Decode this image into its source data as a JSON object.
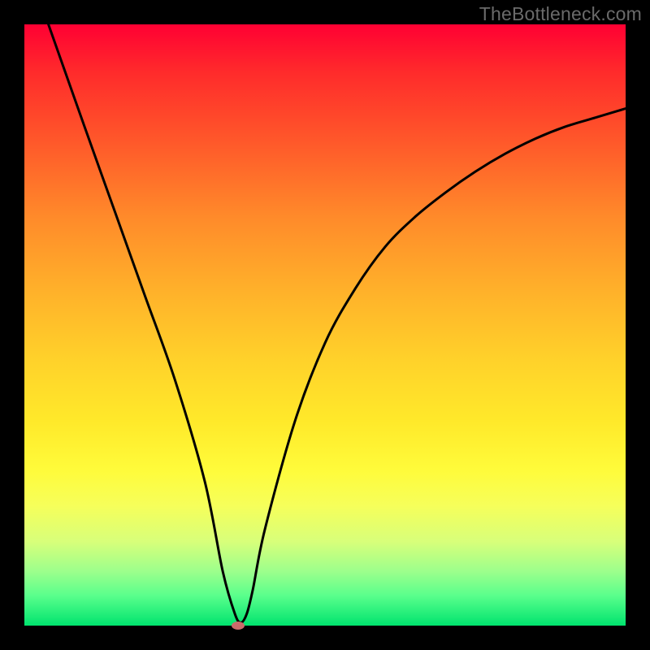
{
  "watermark": "TheBottleneck.com",
  "chart_data": {
    "type": "line",
    "title": "",
    "xlabel": "",
    "ylabel": "",
    "xlim": [
      0,
      100
    ],
    "ylim": [
      0,
      100
    ],
    "series": [
      {
        "name": "bottleneck-curve",
        "x": [
          4,
          10,
          15,
          20,
          25,
          30,
          33,
          35,
          36,
          37,
          38,
          40,
          45,
          50,
          55,
          60,
          65,
          70,
          75,
          80,
          85,
          90,
          95,
          100
        ],
        "values": [
          100,
          83,
          69,
          55,
          41,
          24,
          9,
          2,
          0.5,
          2,
          6,
          16,
          34,
          47,
          56,
          63,
          68,
          72,
          75.5,
          78.5,
          81,
          83,
          84.5,
          86
        ]
      }
    ],
    "marker": {
      "x": 35.5,
      "y": 0,
      "color": "#cc6b6b"
    },
    "gradient_stops": [
      {
        "pos": 0,
        "color": "#ff0033"
      },
      {
        "pos": 50,
        "color": "#ffc82a"
      },
      {
        "pos": 80,
        "color": "#fffb3a"
      },
      {
        "pos": 100,
        "color": "#00e36e"
      }
    ]
  }
}
